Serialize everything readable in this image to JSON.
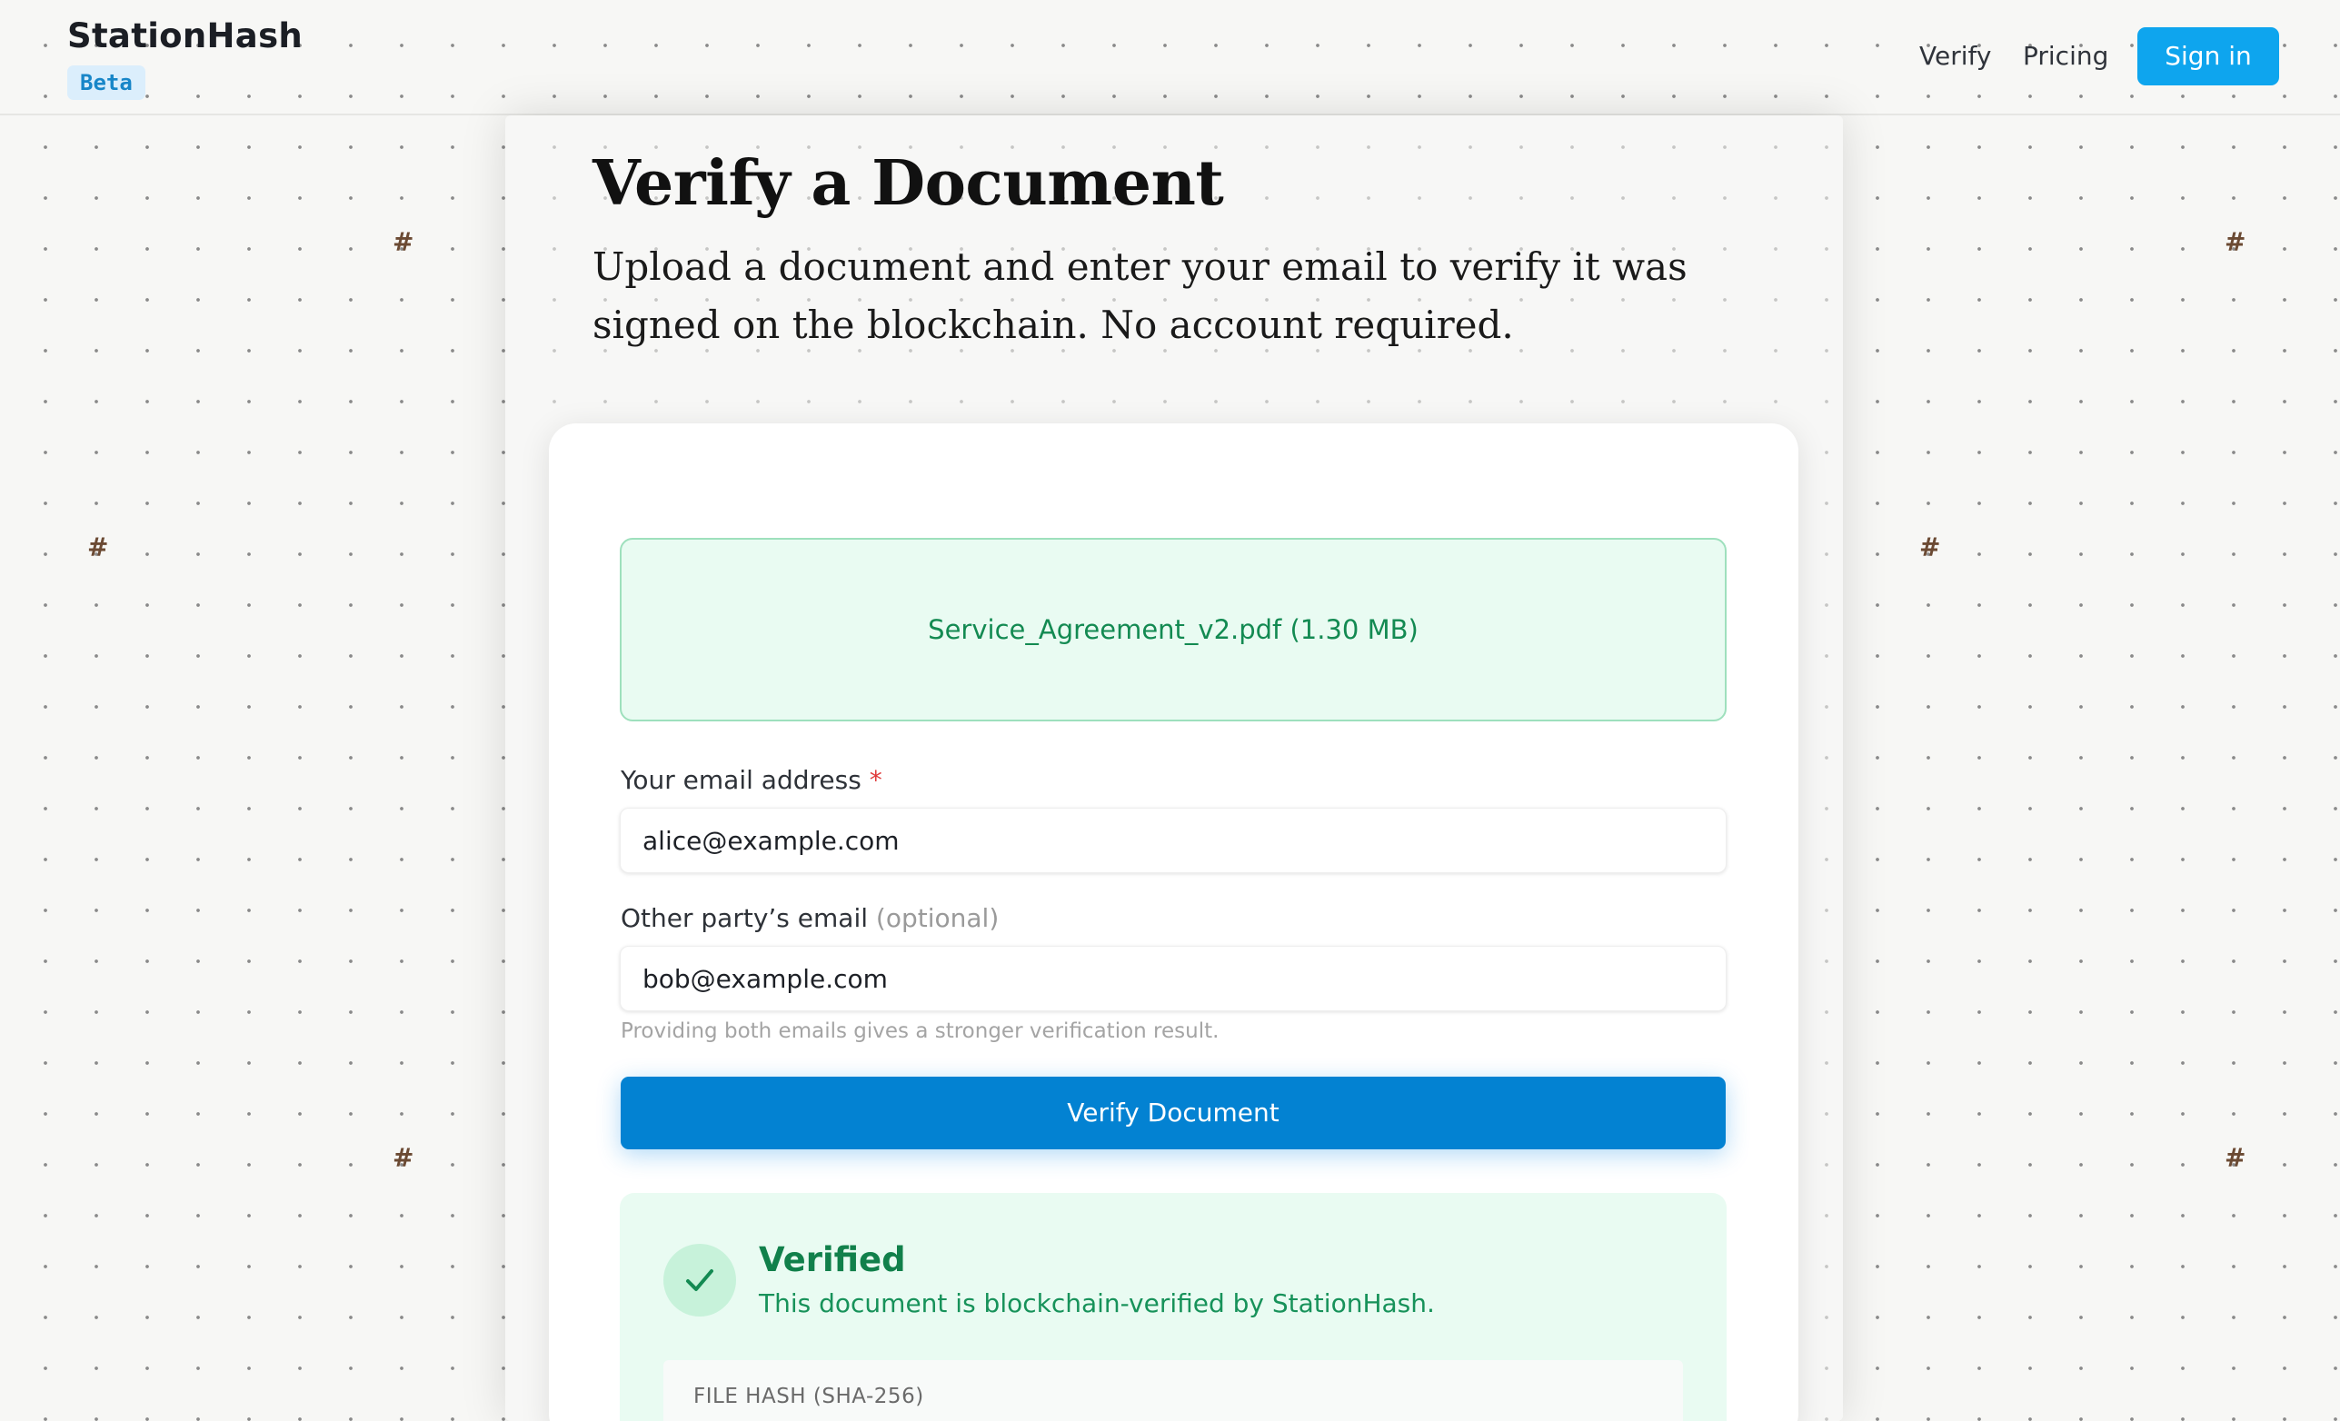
{
  "header": {
    "brand": "StationHash",
    "badge": "Beta",
    "nav": [
      "Verify",
      "Pricing"
    ],
    "sign_in": "Sign in"
  },
  "decor": {
    "hash_glyph": "#"
  },
  "page": {
    "title": "Verify a Document",
    "subtitle": "Upload a document and enter your email to verify it was signed on the blockchain. No account required."
  },
  "upload": {
    "file_label": "Service_Agreement_v2.pdf (1.30 MB)"
  },
  "form": {
    "email_label": "Your email address",
    "email_required_marker": "*",
    "email_value": "alice@example.com",
    "other_label": "Other party’s email",
    "other_optional": "(optional)",
    "other_value": "bob@example.com",
    "hint": "Providing both emails gives a stronger verification result.",
    "submit": "Verify Document"
  },
  "result": {
    "icon": "check-icon",
    "title": "Verified",
    "description": "This document is blockchain-verified by StationHash.",
    "hash_label": "FILE HASH (SHA-256)"
  },
  "colors": {
    "accent": "#0382d2",
    "sign_in": "#0ea5ee",
    "success_bg": "#e9fbf2",
    "success_text": "#11804b",
    "required": "#e03a3a"
  }
}
